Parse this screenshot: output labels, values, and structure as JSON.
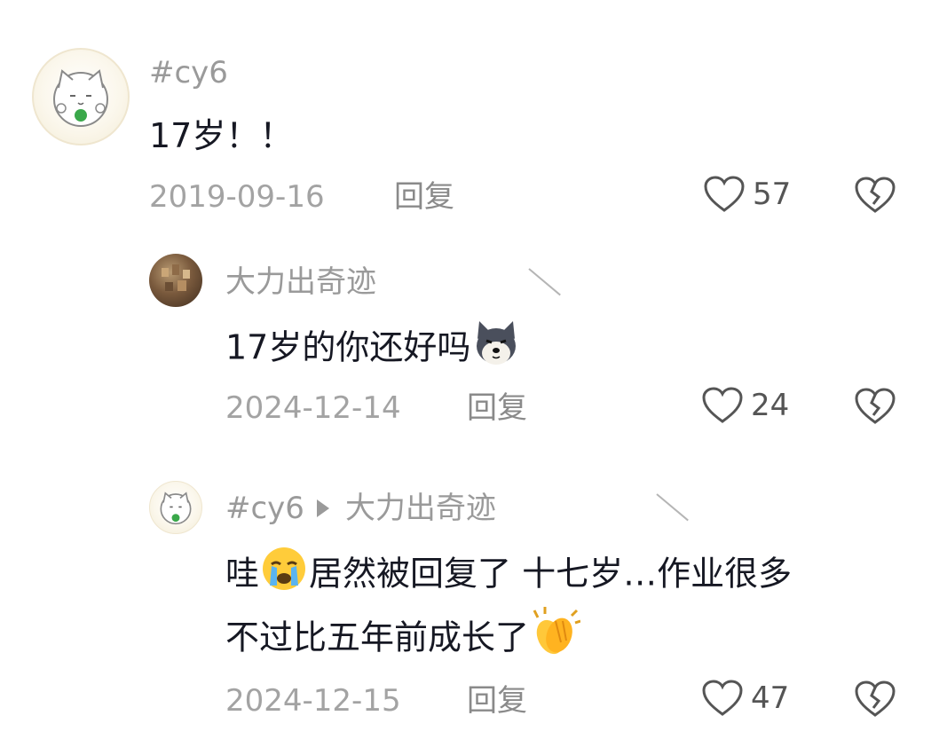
{
  "comments": [
    {
      "username": "#cy6",
      "text": "17岁！！",
      "date": "2019-09-16",
      "reply_label": "回复",
      "likes": "57",
      "avatar_icon": "cat-avatar"
    },
    {
      "username": "大力出奇迹",
      "text": "17岁的你还好吗",
      "emoji": "dog-emoji",
      "date": "2024-12-14",
      "reply_label": "回复",
      "likes": "24",
      "avatar_icon": "photo-avatar"
    },
    {
      "username": "#cy6",
      "reply_to": "大力出奇迹",
      "text_line1_a": "哇",
      "text_line1_b": "居然被回复了 十七岁…作业很多",
      "text_line2": "不过比五年前成长了",
      "emoji_a": "crying-face-emoji",
      "emoji_b": "clapping-hands-emoji",
      "date": "2024-12-15",
      "reply_label": "回复",
      "likes": "47",
      "avatar_icon": "cat-avatar"
    }
  ],
  "colors": {
    "text": "#161823",
    "meta": "#a3a3a3",
    "icon": "#555555"
  }
}
